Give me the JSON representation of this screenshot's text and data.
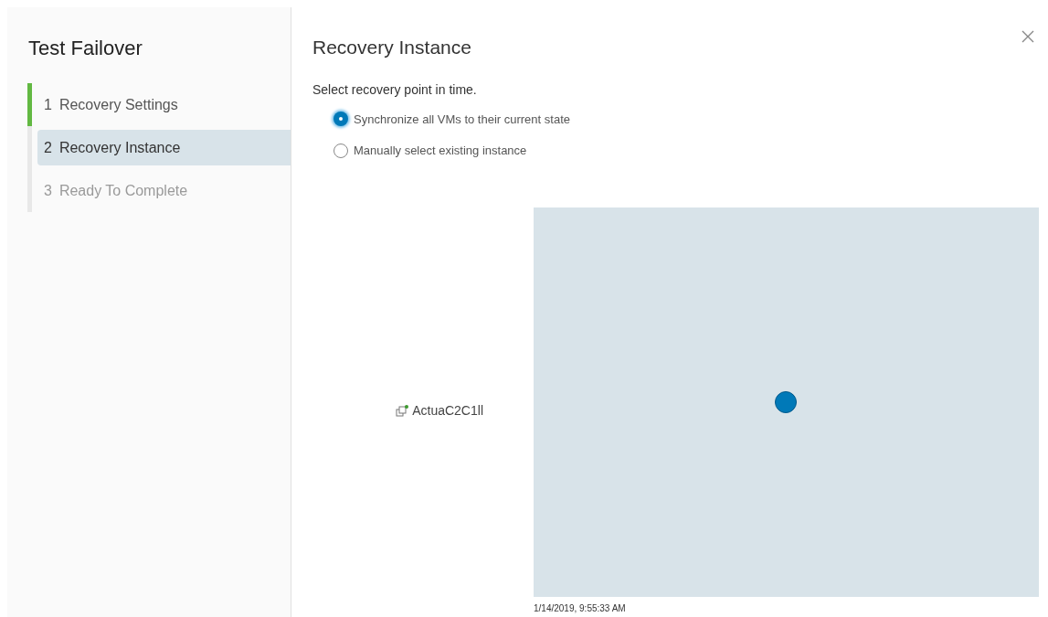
{
  "wizard": {
    "title": "Test Failover"
  },
  "steps": [
    {
      "number": "1",
      "label": "Recovery Settings",
      "selected": false,
      "completed": true
    },
    {
      "number": "2",
      "label": "Recovery Instance",
      "selected": true,
      "completed": false
    },
    {
      "number": "3",
      "label": "Ready To Complete",
      "selected": false,
      "completed": false
    }
  ],
  "page": {
    "title": "Recovery Instance",
    "prompt": "Select recovery point in time."
  },
  "options": [
    {
      "label": "Synchronize all VMs to their current state",
      "selected": true
    },
    {
      "label": "Manually select existing instance",
      "selected": false
    }
  ],
  "timeline": {
    "row_label": "ActuaC2C1ll",
    "timestamp": "1/14/2019, 9:55:33 AM"
  }
}
